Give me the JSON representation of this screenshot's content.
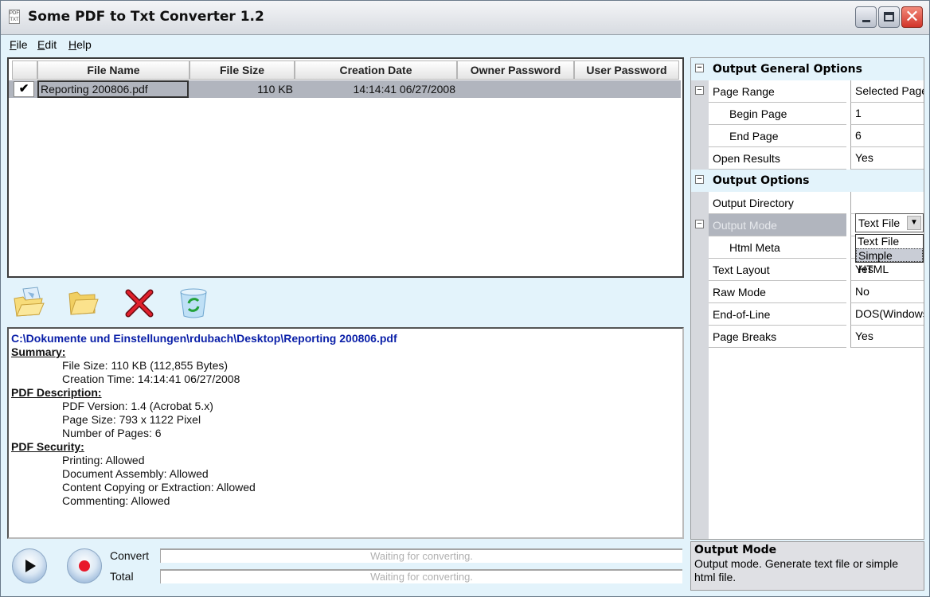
{
  "window": {
    "title": "Some PDF to Txt Converter 1.2",
    "buttons": {
      "minimize": "minimize",
      "maximize": "maximize",
      "close": "✕"
    }
  },
  "menu": [
    {
      "label": "File",
      "mnemonic": "F",
      "rest": "ile"
    },
    {
      "label": "Edit",
      "mnemonic": "E",
      "rest": "dit"
    },
    {
      "label": "Help",
      "mnemonic": "H",
      "rest": "elp"
    }
  ],
  "file_list": {
    "columns": [
      "File Name",
      "File Size",
      "Creation Date",
      "Owner Password",
      "User Password"
    ],
    "rows": [
      {
        "checked": true,
        "check_glyph": "✔",
        "file_name": "Reporting 200806.pdf",
        "file_size": "110 KB",
        "creation_date": "14:14:41 06/27/2008",
        "owner_password": "",
        "user_password": ""
      }
    ]
  },
  "toolbar": {
    "icons": [
      "add-files-icon",
      "open-folder-icon",
      "remove-icon",
      "clear-list-icon"
    ]
  },
  "info": {
    "path": "C:\\Dokumente und Einstellungen\\rdubach\\Desktop\\Reporting 200806.pdf",
    "sections": [
      {
        "title": "Summary:",
        "items": [
          "File Size: 110 KB (112,855 Bytes)",
          "Creation Time: 14:14:41 06/27/2008"
        ]
      },
      {
        "title": "PDF Description:",
        "items": [
          "PDF Version: 1.4 (Acrobat 5.x)",
          "Page Size: 793 x 1122 Pixel",
          "Number of Pages: 6"
        ]
      },
      {
        "title": "PDF Security:",
        "items": [
          "Printing: Allowed",
          "Document Assembly: Allowed",
          "Content Copying or Extraction: Allowed",
          "Commenting: Allowed"
        ]
      }
    ]
  },
  "progress": {
    "convert_label": "Convert",
    "total_label": "Total",
    "convert_status": "Waiting for converting.",
    "total_status": "Waiting for converting.",
    "convert_value": 0,
    "total_value": 0
  },
  "properties": {
    "cat_general": "Output General Options",
    "page_range": {
      "label": "Page Range",
      "value": "Selected Pages"
    },
    "begin_page": {
      "label": "Begin Page",
      "value": "1"
    },
    "end_page": {
      "label": "End Page",
      "value": "6"
    },
    "open_results": {
      "label": "Open Results",
      "value": "Yes"
    },
    "cat_output": "Output Options",
    "output_directory": {
      "label": "Output Directory",
      "value": ""
    },
    "output_mode": {
      "label": "Output Mode",
      "value": "Text File",
      "options": [
        "Text File",
        "Simple HTML"
      ],
      "highlighted": "Simple HTML"
    },
    "html_meta": {
      "label": "Html Meta",
      "value": ""
    },
    "text_layout": {
      "label": "Text Layout",
      "value": "Yes"
    },
    "raw_mode": {
      "label": "Raw Mode",
      "value": "No"
    },
    "end_of_line": {
      "label": "End-of-Line",
      "value": "DOS(Windows)"
    },
    "page_breaks": {
      "label": "Page Breaks",
      "value": "Yes"
    }
  },
  "description": {
    "title": "Output Mode",
    "text": "Output mode. Generate text file or simple html file."
  }
}
